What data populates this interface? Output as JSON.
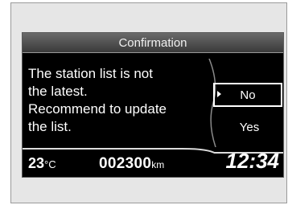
{
  "dialog": {
    "title": "Confirmation",
    "message_lines": [
      "The station list is not",
      "the latest.",
      "Recommend to update",
      "the list."
    ],
    "options": [
      "No",
      "Yes"
    ],
    "selected_option": "No"
  },
  "status": {
    "temperature": "23",
    "temperature_unit": "°C",
    "odometer": "002300",
    "odometer_unit": "km",
    "clock": "12:34"
  },
  "colors": {
    "screen_background": "#000000",
    "frame_background": "#e6e6e6",
    "text": "#ffffff"
  }
}
